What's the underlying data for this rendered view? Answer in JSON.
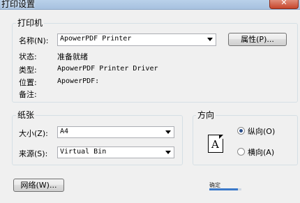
{
  "window": {
    "title": "打印设置",
    "close_glyph": "✕"
  },
  "printer": {
    "group_label": "打印机",
    "name_label": "名称(N):",
    "name_value": "ApowerPDF Printer",
    "properties_button": "属性(P)...",
    "status_label": "状态:",
    "status_value": "准备就绪",
    "type_label": "类型:",
    "type_value": "ApowerPDF Printer Driver",
    "location_label": "位置:",
    "location_value": "ApowerPDF:",
    "comment_label": "备注:"
  },
  "paper": {
    "group_label": "纸张",
    "size_label": "大小(Z):",
    "size_value": "A4",
    "source_label": "来源(S):",
    "source_value": "Virtual Bin"
  },
  "orientation": {
    "group_label": "方向",
    "icon_letter": "A",
    "portrait_label": "纵向(O)",
    "landscape_label": "横向(A)",
    "selected": "portrait"
  },
  "footer": {
    "network_button": "网络(W)...",
    "progress_label": "确定",
    "progress_fraction": 0.9
  }
}
